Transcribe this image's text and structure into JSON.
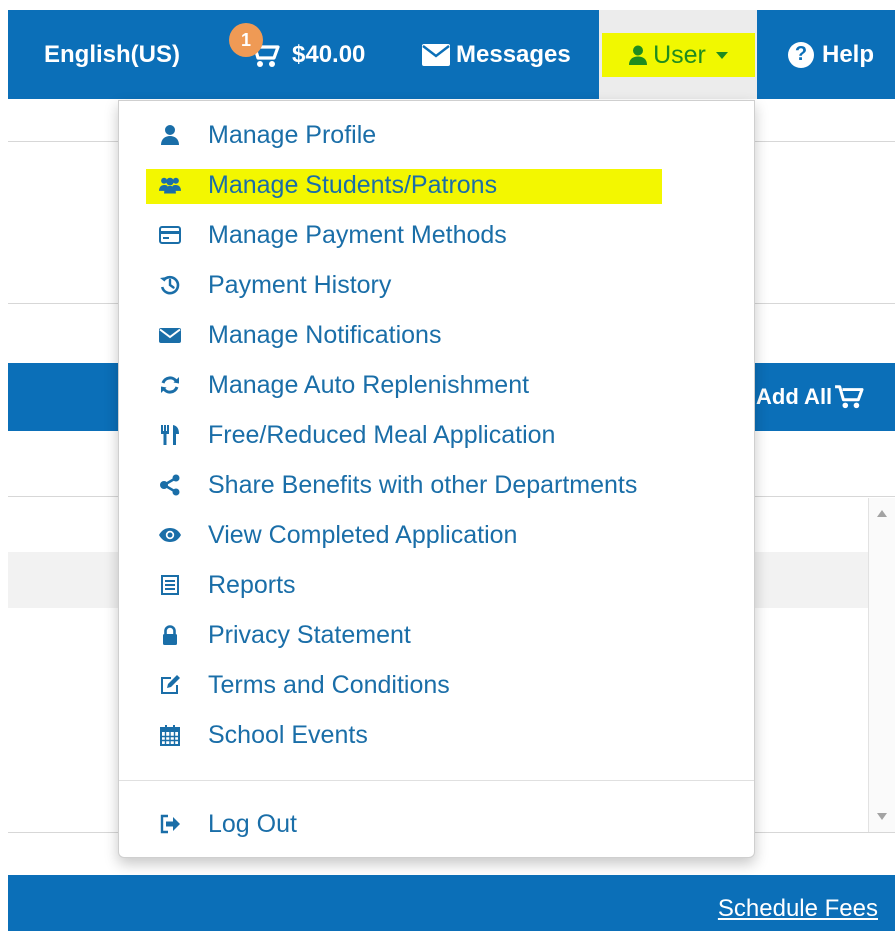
{
  "nav": {
    "language": "English(US)",
    "cart_badge": "1",
    "cart_total": "$40.00",
    "messages": "Messages",
    "user": "User",
    "help": "Help",
    "help_glyph": "?"
  },
  "page": {
    "add_all": "Add All",
    "schedule_fees": "Schedule Fees"
  },
  "menu": {
    "items": [
      {
        "label": "Manage Profile",
        "icon": "user-icon"
      },
      {
        "label": "Manage Students/Patrons",
        "icon": "users-icon",
        "highlighted": true
      },
      {
        "label": "Manage Payment Methods",
        "icon": "credit-card-icon"
      },
      {
        "label": "Payment History",
        "icon": "history-icon"
      },
      {
        "label": "Manage Notifications",
        "icon": "envelope-icon"
      },
      {
        "label": "Manage Auto Replenishment",
        "icon": "refresh-icon"
      },
      {
        "label": "Free/Reduced Meal Application",
        "icon": "cutlery-icon"
      },
      {
        "label": "Share Benefits with other Departments",
        "icon": "share-icon"
      },
      {
        "label": "View Completed Application",
        "icon": "eye-icon"
      },
      {
        "label": "Reports",
        "icon": "report-icon"
      },
      {
        "label": "Privacy Statement",
        "icon": "lock-icon"
      },
      {
        "label": "Terms and Conditions",
        "icon": "edit-icon"
      },
      {
        "label": "School Events",
        "icon": "calendar-icon"
      }
    ],
    "logout": {
      "label": "Log Out",
      "icon": "sign-out-icon"
    }
  },
  "colors": {
    "nav_blue": "#0b6fb8",
    "link_blue": "#1a6ea8",
    "highlight_yellow": "#f3f700",
    "user_green": "#1f8c1f",
    "badge_orange": "#ef9a55"
  }
}
